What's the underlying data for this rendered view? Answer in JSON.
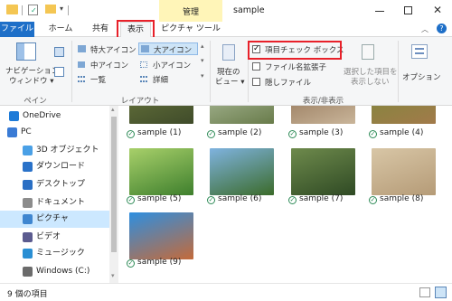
{
  "window": {
    "title": "sample",
    "context_tab": "管理"
  },
  "tabs": {
    "file": "ファイル",
    "home": "ホーム",
    "share": "共有",
    "view": "表示",
    "picture_tools": "ピクチャ ツール"
  },
  "ribbon": {
    "pane": {
      "nav_pane_line1": "ナビゲーション",
      "nav_pane_line2": "ウィンドウ ▾",
      "group": "ペイン"
    },
    "layout": {
      "extra_large": "特大アイコン",
      "large": "大アイコン",
      "medium": "中アイコン",
      "small": "小アイコン",
      "list": "一覧",
      "details": "詳細",
      "group": "レイアウト"
    },
    "current_view": {
      "line1": "現在の",
      "line2": "ビュー ▾"
    },
    "show_hide": {
      "item_checkboxes": "項目チェック ボックス",
      "item_checkboxes_checked": true,
      "file_ext": "ファイル名拡張子",
      "hidden_items": "隠しファイル",
      "hide_selected_line1": "選択した項目を",
      "hide_selected_line2": "表示しない",
      "group": "表示/非表示"
    },
    "options": "オプション"
  },
  "nav": {
    "items": [
      {
        "label": "OneDrive",
        "icon": "cloud-icon",
        "color": "#1e7bd8"
      },
      {
        "label": "PC",
        "icon": "pc-icon",
        "color": "#3a7bd5"
      },
      {
        "label": "3D オブジェクト",
        "icon": "cube-icon",
        "color": "#4aa0e6"
      },
      {
        "label": "ダウンロード",
        "icon": "download-icon",
        "color": "#2a72c9"
      },
      {
        "label": "デスクトップ",
        "icon": "desktop-icon",
        "color": "#2a6fc4"
      },
      {
        "label": "ドキュメント",
        "icon": "document-icon",
        "color": "#8c8c8c"
      },
      {
        "label": "ピクチャ",
        "icon": "pictures-icon",
        "color": "#3f86d0"
      },
      {
        "label": "ビデオ",
        "icon": "video-icon",
        "color": "#5b5b8f"
      },
      {
        "label": "ミュージック",
        "icon": "music-icon",
        "color": "#2a8fd4"
      },
      {
        "label": "Windows (C:)",
        "icon": "drive-icon",
        "color": "#6b6b6b"
      }
    ]
  },
  "files": [
    {
      "name": "sample (1)",
      "c1": "#6d7a3e",
      "c2": "#3f4b2a"
    },
    {
      "name": "sample (2)",
      "c1": "#b8c6a8",
      "c2": "#687b4a"
    },
    {
      "name": "sample (3)",
      "c1": "#8a6a4c",
      "c2": "#c9b59a"
    },
    {
      "name": "sample (4)",
      "c1": "#7a8a3a",
      "c2": "#a27a4a"
    },
    {
      "name": "sample (5)",
      "c1": "#a8d06a",
      "c2": "#3e7f2d"
    },
    {
      "name": "sample (6)",
      "c1": "#7fb3e0",
      "c2": "#3b6b2a"
    },
    {
      "name": "sample (7)",
      "c1": "#6e8a4c",
      "c2": "#2f4a24"
    },
    {
      "name": "sample (8)",
      "c1": "#d8c6a6",
      "c2": "#b59b77"
    },
    {
      "name": "sample (9)",
      "c1": "#2e8fe0",
      "c2": "#c46a3a"
    }
  ],
  "status": {
    "count": "9 個の項目"
  },
  "colors": {
    "accent": "#1e6fc8",
    "highlight_box": "#e8212a",
    "context_tab_bg": "#fff5b8"
  }
}
